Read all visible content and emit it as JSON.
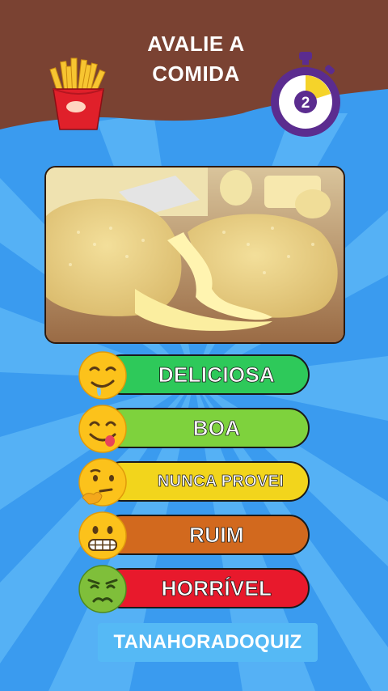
{
  "header": {
    "title_line1": "AVALIE A",
    "title_line2": "COMIDA",
    "timer_value": "2"
  },
  "food_image": {
    "icon": "pastel-with-cheese-photo"
  },
  "options": [
    {
      "label": "DELICIOSA",
      "color": "#2ec95a",
      "emoji": "drooling-face"
    },
    {
      "label": "BOA",
      "color": "#7ed23d",
      "emoji": "yummy-face"
    },
    {
      "label": "NUNCA PROVEI",
      "color": "#f2d51c",
      "emoji": "thinking-face"
    },
    {
      "label": "RUIM",
      "color": "#d2691e",
      "emoji": "grimacing-face"
    },
    {
      "label": "HORRÍVEL",
      "color": "#e8192c",
      "emoji": "nauseated-face"
    }
  ],
  "footer": {
    "brand": "TANAHORADOQUIZ"
  },
  "colors": {
    "header_brown": "#7a4232",
    "sky_blue": "#3d9ff0",
    "ray_blue": "#5bb6f7",
    "timer_purple": "#5b2c8f"
  }
}
